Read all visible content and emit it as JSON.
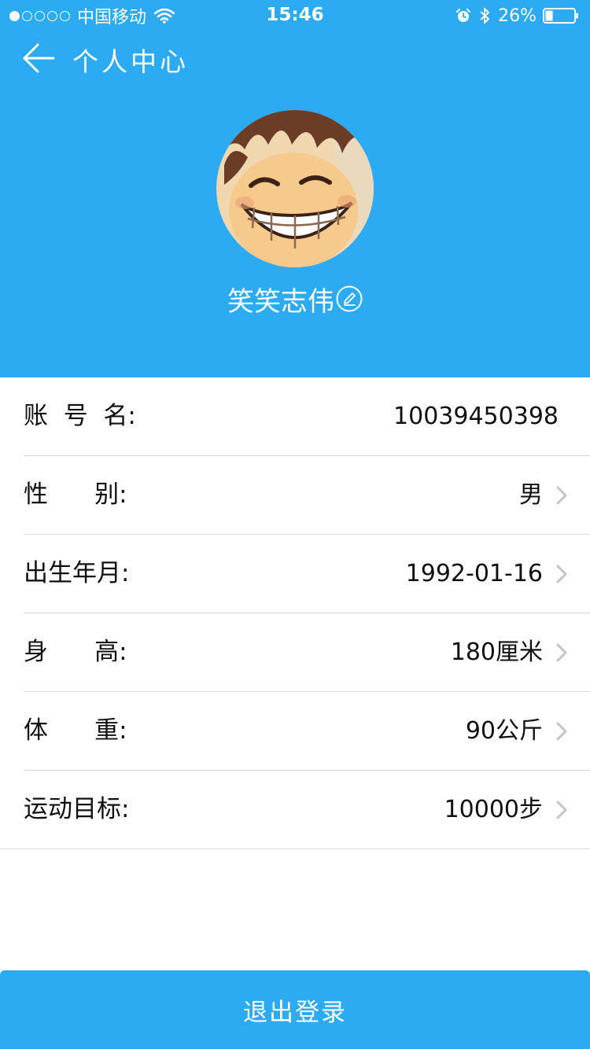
{
  "status_bar": {
    "carrier": "中国移动",
    "time": "15:46",
    "battery": "26%",
    "signal_bars_filled": 1,
    "signal_bars_total": 5,
    "icons": [
      "signal-icon",
      "wifi-icon",
      "alarm-icon",
      "bluetooth-icon",
      "battery-icon"
    ]
  },
  "header": {
    "title": "个人中心",
    "back_icon": "arrow-left-icon",
    "background_color": "#2caaf2"
  },
  "profile": {
    "avatar": "avatar",
    "nickname": "笑笑志伟",
    "edit_icon": "pencil-icon"
  },
  "fields": [
    {
      "label": "账  号  名:",
      "value": "10039450398",
      "editable": false
    },
    {
      "label": "性      别:",
      "value": "男",
      "editable": true
    },
    {
      "label": "出生年月:",
      "value": "1992-01-16",
      "editable": true
    },
    {
      "label": "身      高:",
      "value": "180厘米",
      "editable": true
    },
    {
      "label": "体      重:",
      "value": "90公斤",
      "editable": true
    },
    {
      "label": "运动目标:",
      "value": "10000步",
      "editable": true
    }
  ],
  "logout": {
    "label": "退出登录"
  }
}
